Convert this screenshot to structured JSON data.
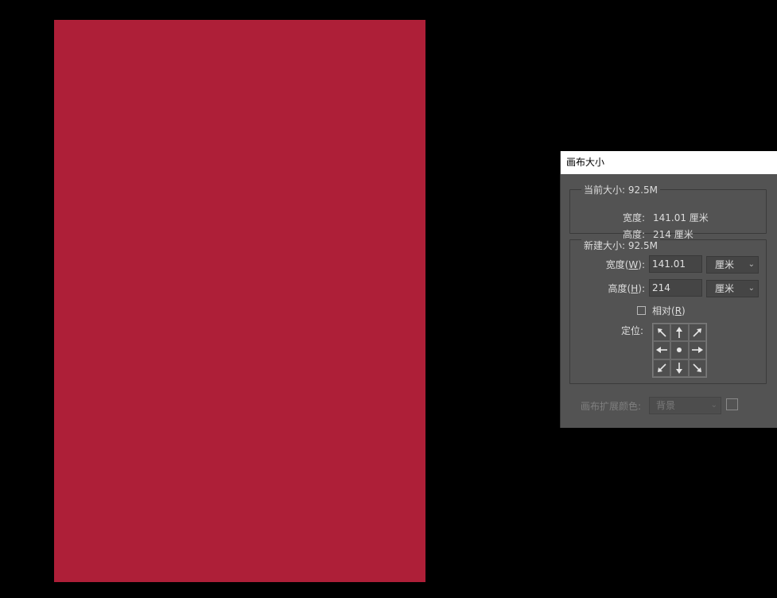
{
  "canvas": {
    "color": "#ae1f38"
  },
  "dialog": {
    "title": "画布大小",
    "current": {
      "legend": "当前大小: 92.5M",
      "width_label": "宽度:",
      "width_value": "141.01 厘米",
      "height_label": "高度:",
      "height_value": "214 厘米"
    },
    "new": {
      "legend": "新建大小: 92.5M",
      "width_label_pre": "宽度(",
      "width_label_key": "W",
      "width_label_post": "):",
      "width_value": "141.01",
      "width_unit": "厘米",
      "height_label_pre": "高度(",
      "height_label_key": "H",
      "height_label_post": "):",
      "height_value": "214",
      "height_unit": "厘米",
      "relative_pre": "相对(",
      "relative_key": "R",
      "relative_post": ")",
      "relative_checked": false,
      "anchor_label": "定位:",
      "anchor_icons": [
        "arrow-up-left-icon",
        "arrow-up-icon",
        "arrow-up-right-icon",
        "arrow-left-icon",
        "anchor-center-dot-icon",
        "arrow-right-icon",
        "arrow-down-left-icon",
        "arrow-down-icon",
        "arrow-down-right-icon"
      ]
    },
    "extension": {
      "label": "画布扩展颜色:",
      "value": "背景"
    }
  }
}
